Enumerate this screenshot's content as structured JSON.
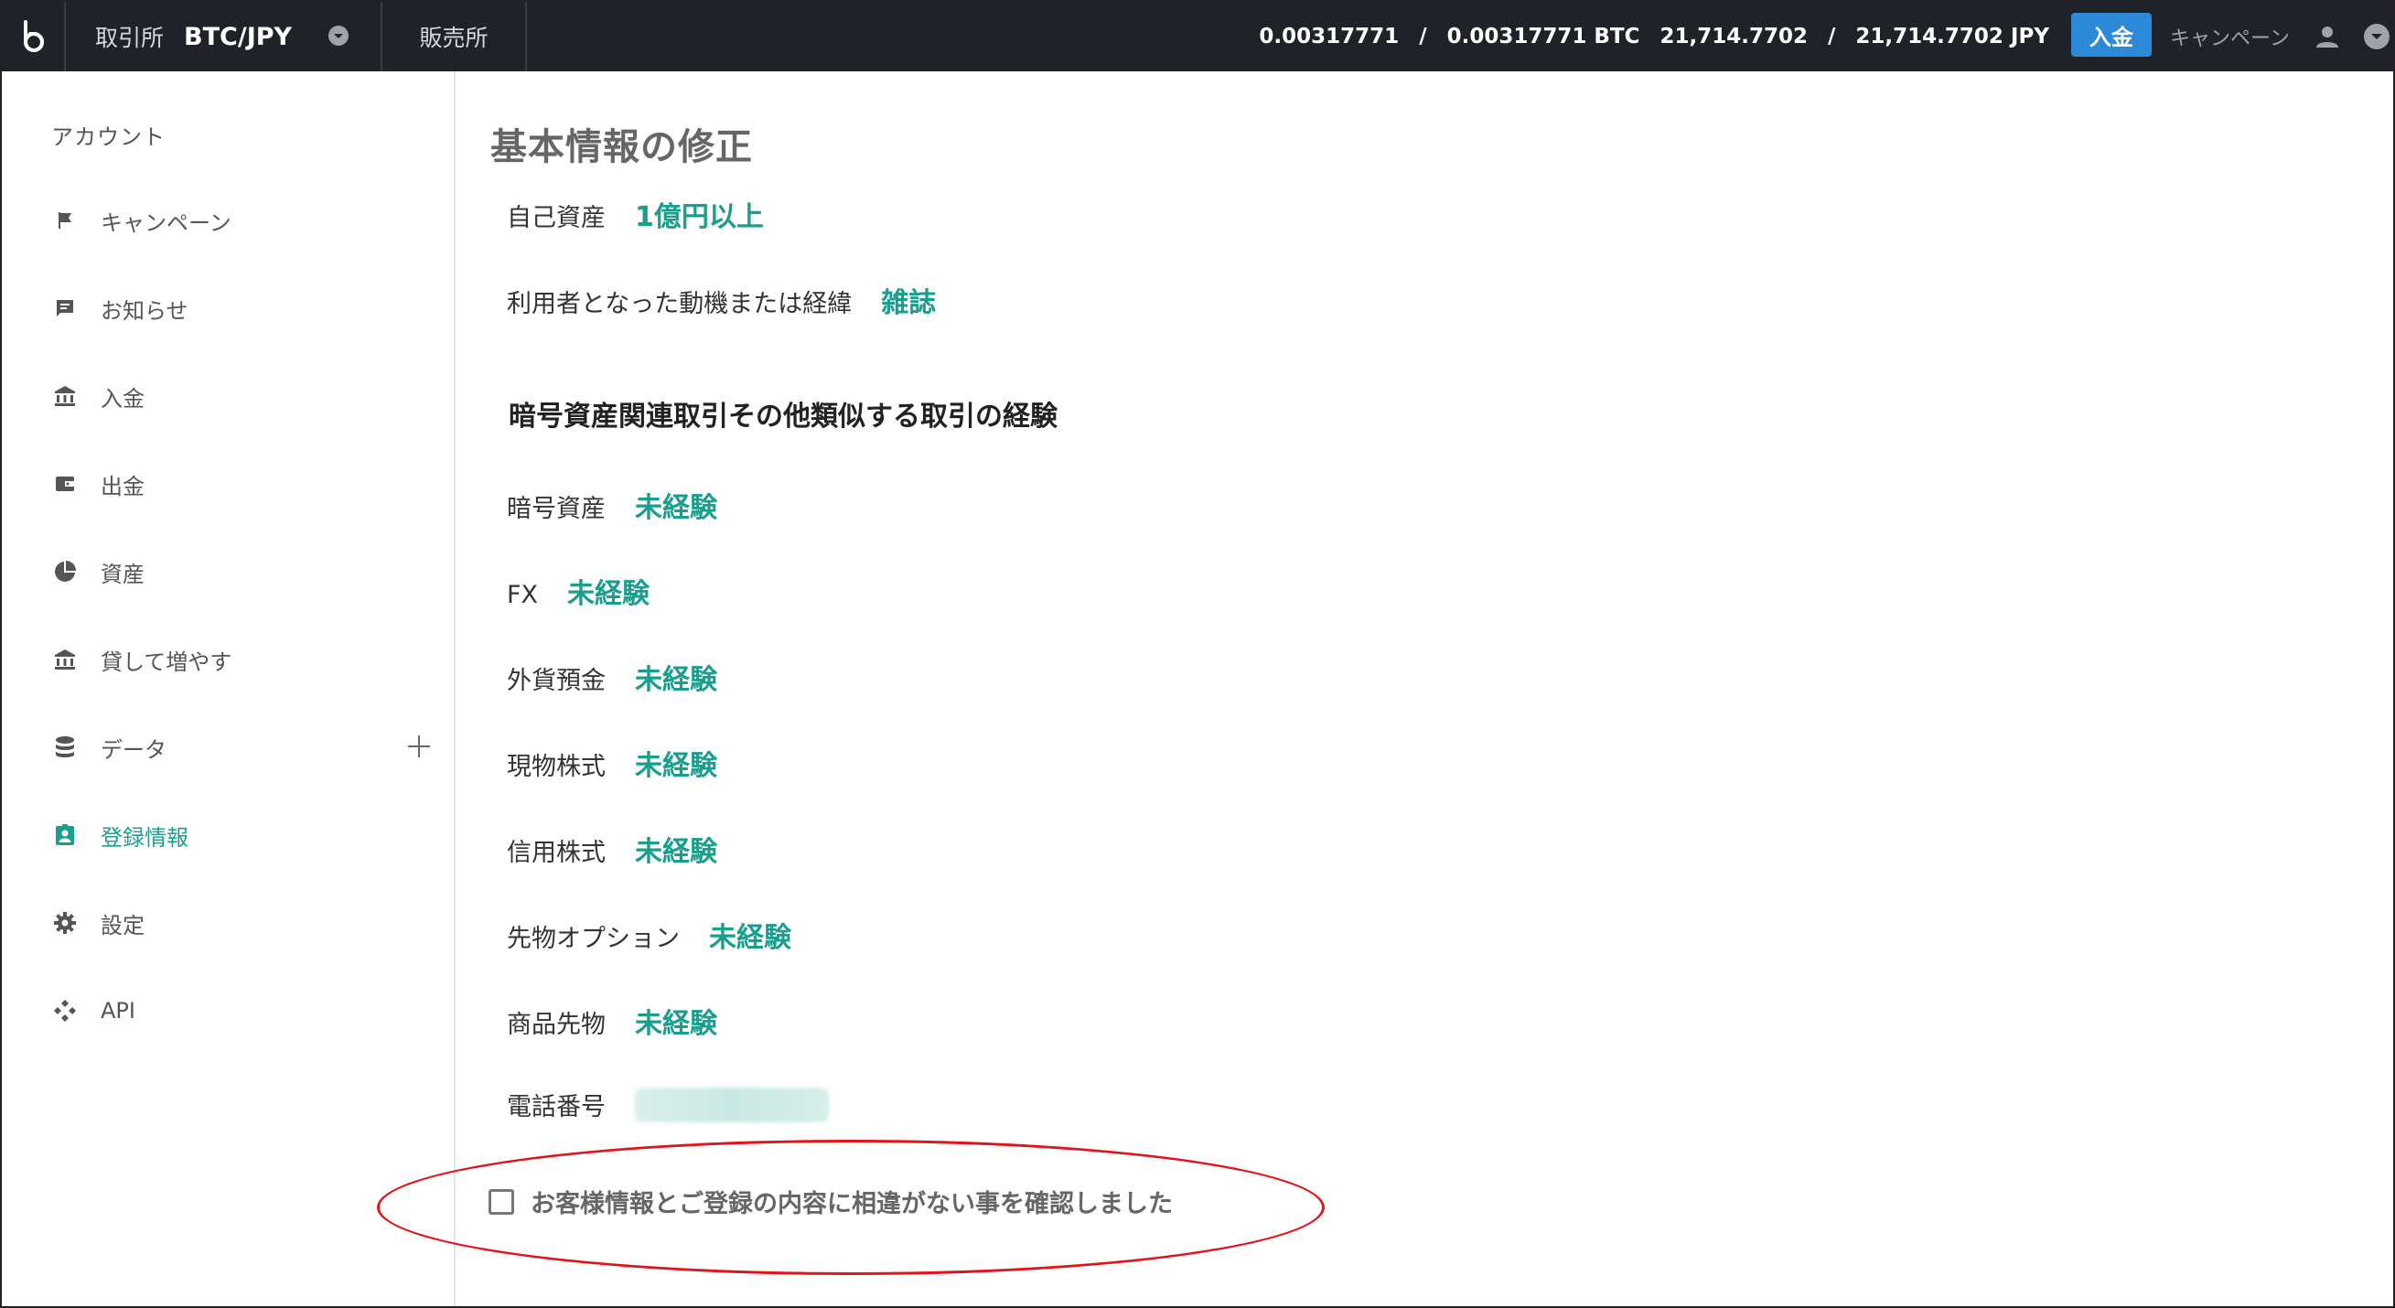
{
  "topbar": {
    "logo": "bitbank-logo-icon",
    "market_label": "取引所",
    "pair": "BTC/JPY",
    "sales_label": "販売所",
    "btc_balance_available": "0.00317771",
    "btc_balance_total": "0.00317771 BTC",
    "jpy_balance_available": "21,714.7702",
    "jpy_balance_total": "21,714.7702 JPY",
    "separator": "/",
    "deposit_button": "入金",
    "campaign_link": "キャンペーン",
    "icons": [
      "user-icon",
      "chevron-down-icon"
    ]
  },
  "sidebar": {
    "title": "アカウント",
    "items": [
      {
        "label": "キャンペーン",
        "icon": "flag-icon"
      },
      {
        "label": "お知らせ",
        "icon": "message-icon"
      },
      {
        "label": "入金",
        "icon": "bank-icon"
      },
      {
        "label": "出金",
        "icon": "wallet-icon"
      },
      {
        "label": "資産",
        "icon": "pie-chart-icon"
      },
      {
        "label": "貸して増やす",
        "icon": "bank-icon"
      },
      {
        "label": "データ",
        "icon": "database-icon"
      },
      {
        "label": "登録情報",
        "icon": "contact-card-icon",
        "active": true
      },
      {
        "label": "設定",
        "icon": "gear-icon"
      },
      {
        "label": "API",
        "icon": "api-icon"
      }
    ]
  },
  "main": {
    "title": "基本情報の修正",
    "assets_label": "自己資産",
    "assets_value": "1億円以上",
    "motive_label": "利用者となった動機または経緯",
    "motive_value": "雑誌",
    "experience_heading": "暗号資産関連取引その他類似する取引の経験",
    "experience": [
      {
        "label": "暗号資産",
        "value": "未経験"
      },
      {
        "label": "FX",
        "value": "未経験"
      },
      {
        "label": "外貨預金",
        "value": "未経験"
      },
      {
        "label": "現物株式",
        "value": "未経験"
      },
      {
        "label": "信用株式",
        "value": "未経験"
      },
      {
        "label": "先物オプション",
        "value": "未経験"
      },
      {
        "label": "商品先物",
        "value": "未経験"
      }
    ],
    "phone_label": "電話番号",
    "confirm_text": "お客様情報とご登録の内容に相違がない事を確認しました",
    "confirm_checked": false
  },
  "colors": {
    "accent": "#1a9f8f",
    "topbar_bg": "#1f2329",
    "deposit_button": "#2d8ad8",
    "annotation": "#e0151b"
  }
}
